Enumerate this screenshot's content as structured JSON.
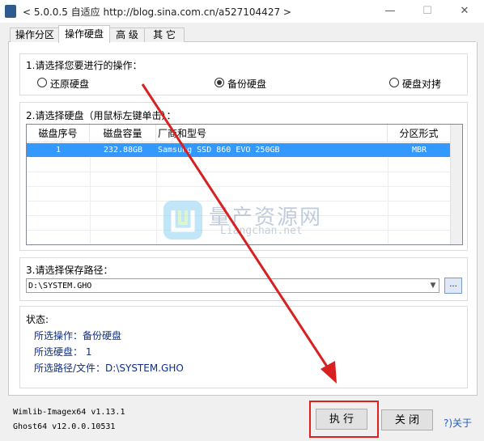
{
  "window": {
    "title": "< 5.0.0.5 自适应 http://blog.sina.com.cn/a527104427 >",
    "minimize_icon": "minimize-icon",
    "maximize_icon": "maximize-icon",
    "close_icon": "close-icon",
    "minimize_glyph": "—",
    "maximize_glyph": "☐",
    "close_glyph": "✕"
  },
  "tabs": [
    {
      "label": "操作分区",
      "active": false
    },
    {
      "label": "操作硬盘",
      "active": true
    },
    {
      "label": "高 级",
      "active": false
    },
    {
      "label": "其 它",
      "active": false
    }
  ],
  "operation": {
    "heading": "1.请选择您要进行的操作：",
    "options": [
      {
        "label": "还原硬盘",
        "checked": false
      },
      {
        "label": "备份硬盘",
        "checked": true
      },
      {
        "label": "硬盘对拷",
        "checked": false
      }
    ]
  },
  "disk": {
    "heading": "2.请选择硬盘（用鼠标左键单击）：",
    "columns": [
      "磁盘序号",
      "磁盘容量",
      "厂商和型号",
      "分区形式"
    ],
    "rows": [
      {
        "index": "1",
        "size": "232.88GB",
        "model": "Samsung SSD 860 EVO 250GB",
        "partition": "MBR",
        "selected": true
      }
    ]
  },
  "path": {
    "heading": "3.请选择保存路径：",
    "value": "D:\\SYSTEM.GHO",
    "browse_label": "..."
  },
  "status": {
    "heading": "状态:",
    "lines": [
      "所选操作：备份硬盘",
      "所选硬盘：  1",
      "所选路径/文件：D:\\SYSTEM.GHO"
    ]
  },
  "footer": {
    "wimlib": "Wimlib-Imagex64 v1.13.1",
    "ghost": "Ghost64 v12.0.0.10531",
    "execute_label": "执 行",
    "close_label": "关 闭",
    "about_label": "?)关于"
  },
  "watermark": {
    "cn": "量产资源网",
    "en": "Liangchan.net"
  },
  "colors": {
    "selection": "#3399ff",
    "status_text": "#0d2f88",
    "annotation_red": "#e02020"
  }
}
